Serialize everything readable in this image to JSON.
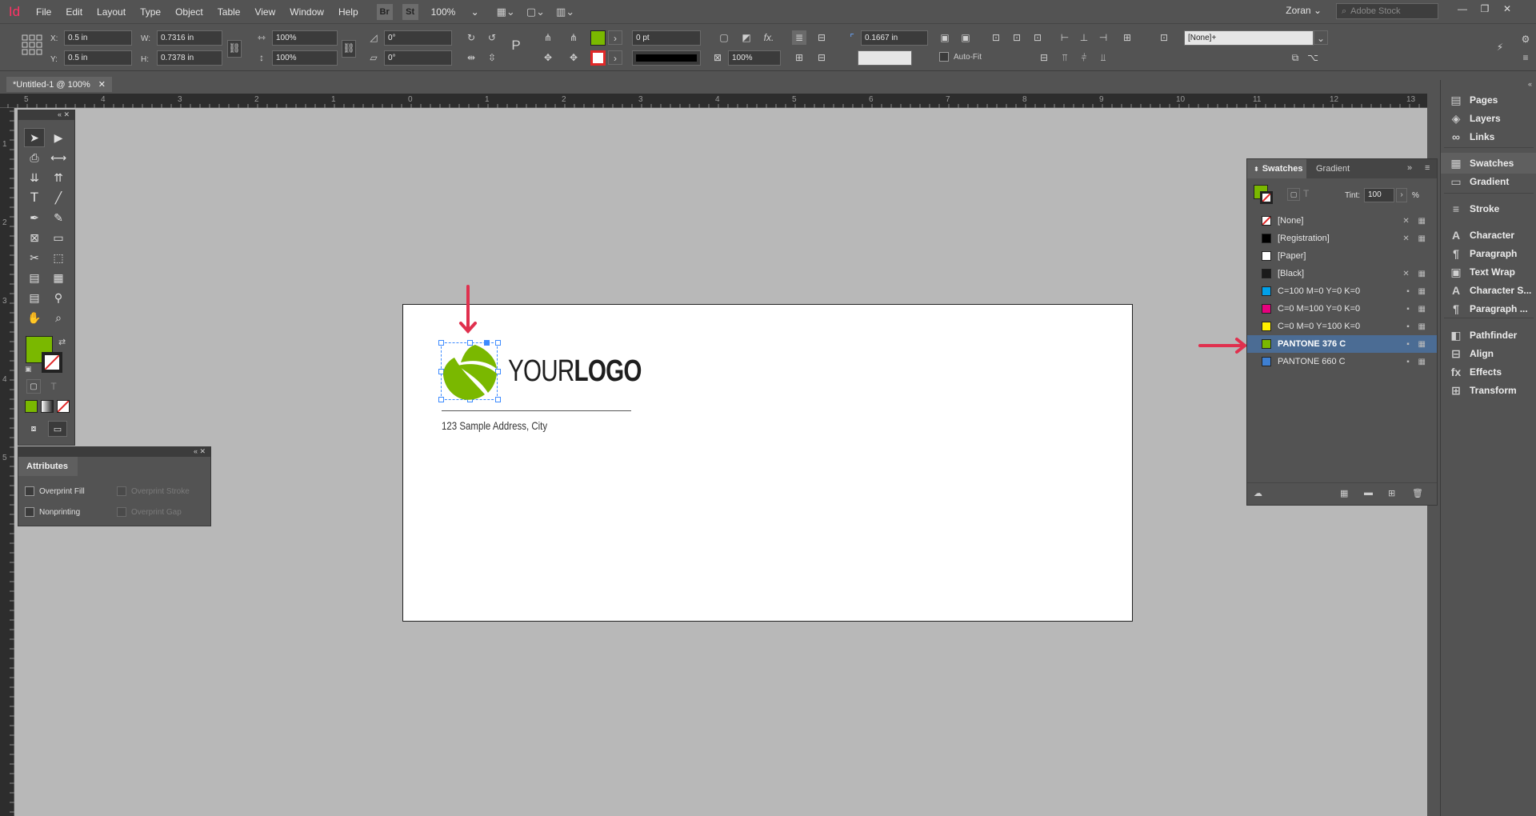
{
  "app": {
    "logo": "Id",
    "user": "Zoran",
    "stock_placeholder": "Adobe Stock"
  },
  "menu": [
    "File",
    "Edit",
    "Layout",
    "Type",
    "Object",
    "Table",
    "View",
    "Window",
    "Help"
  ],
  "appbar": {
    "bridge": "Br",
    "stock": "St",
    "zoom": "100%"
  },
  "control": {
    "x_label": "X:",
    "y_label": "Y:",
    "w_label": "W:",
    "h_label": "H:",
    "x": "0.5 in",
    "y": "0.5 in",
    "w": "0.7316 in",
    "h": "0.7378 in",
    "scale_x": "100%",
    "scale_y": "100%",
    "rotate": "0°",
    "shear": "0°",
    "stroke_weight": "0 pt",
    "opacity": "100%",
    "corner": "0.1667 in",
    "autofit": "Auto-Fit",
    "object_style": "[None]+",
    "fill_color": "#7ab800"
  },
  "doc": {
    "tab": "*Untitled-1 @ 100%",
    "close": "✕"
  },
  "rulers": {
    "h": [
      "5",
      "4",
      "3",
      "2",
      "1",
      "0",
      "1",
      "2",
      "3",
      "4",
      "5",
      "6",
      "7",
      "8",
      "9",
      "10",
      "11",
      "12",
      "13"
    ],
    "v": [
      "1",
      "2",
      "3",
      "4",
      "5"
    ]
  },
  "page_content": {
    "logo_light": "YOUR",
    "logo_bold": "LOGO",
    "address": "123 Sample Address, City",
    "logo_color": "#7ab800"
  },
  "attributes": {
    "title": "Attributes",
    "overprint_fill": "Overprint Fill",
    "overprint_stroke": "Overprint Stroke",
    "nonprinting": "Nonprinting",
    "overprint_gap": "Overprint Gap"
  },
  "swatches": {
    "tab_swatches": "Swatches",
    "tab_gradient": "Gradient",
    "tint_label": "Tint:",
    "tint_value": "100",
    "percent": "%",
    "items": [
      {
        "name": "[None]",
        "color": "#ffffff",
        "selected": false
      },
      {
        "name": "[Registration]",
        "color": "#000000",
        "selected": false
      },
      {
        "name": "[Paper]",
        "color": "#ffffff",
        "selected": false
      },
      {
        "name": "[Black]",
        "color": "#1a1a1a",
        "selected": false
      },
      {
        "name": "C=100 M=0 Y=0 K=0",
        "color": "#00a0e9",
        "selected": false
      },
      {
        "name": "C=0 M=100 Y=0 K=0",
        "color": "#e6007e",
        "selected": false
      },
      {
        "name": "C=0 M=0 Y=100 K=0",
        "color": "#fff100",
        "selected": false
      },
      {
        "name": "PANTONE 376 C",
        "color": "#7ab800",
        "selected": true
      },
      {
        "name": "PANTONE 660 C",
        "color": "#3e7fd1",
        "selected": false
      }
    ]
  },
  "dock": [
    {
      "label": "Pages",
      "icon": "pages-icon",
      "glyph": "▤"
    },
    {
      "label": "Layers",
      "icon": "layers-icon",
      "glyph": "◈"
    },
    {
      "label": "Links",
      "icon": "links-icon",
      "glyph": "∞"
    },
    {
      "label": "Swatches",
      "icon": "swatches-icon",
      "glyph": "▦"
    },
    {
      "label": "Gradient",
      "icon": "gradient-icon",
      "glyph": "▭"
    },
    {
      "label": "Stroke",
      "icon": "stroke-icon",
      "glyph": "≡"
    },
    {
      "label": "Character",
      "icon": "character-icon",
      "glyph": "A"
    },
    {
      "label": "Paragraph",
      "icon": "paragraph-icon",
      "glyph": "¶"
    },
    {
      "label": "Text Wrap",
      "icon": "text-wrap-icon",
      "glyph": "▣"
    },
    {
      "label": "Character S...",
      "icon": "character-styles-icon",
      "glyph": "A"
    },
    {
      "label": "Paragraph ...",
      "icon": "paragraph-styles-icon",
      "glyph": "¶"
    },
    {
      "label": "Pathfinder",
      "icon": "pathfinder-icon",
      "glyph": "◧"
    },
    {
      "label": "Align",
      "icon": "align-icon",
      "glyph": "⊟"
    },
    {
      "label": "Effects",
      "icon": "effects-icon",
      "glyph": "fx"
    },
    {
      "label": "Transform",
      "icon": "transform-icon",
      "glyph": "⊞"
    }
  ],
  "annotation_color": "#e0304e"
}
